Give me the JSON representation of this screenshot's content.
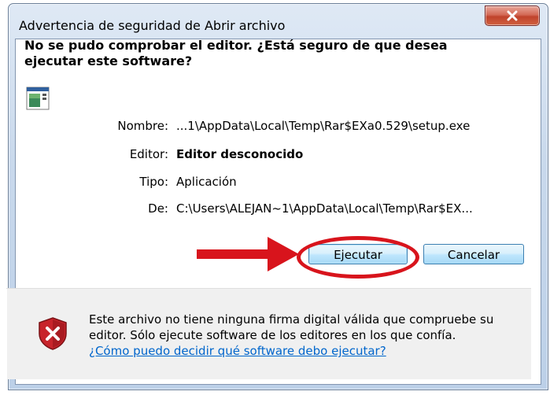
{
  "window": {
    "title": "Advertencia de seguridad de Abrir archivo"
  },
  "dialog": {
    "heading": "No se pudo comprobar el editor. ¿Está seguro de que desea ejecutar este software?",
    "fields": [
      {
        "label": "Nombre:",
        "value": "...1\\AppData\\Local\\Temp\\Rar$EXa0.529\\setup.exe"
      },
      {
        "label": "Editor:",
        "value": "Editor desconocido"
      },
      {
        "label": "Tipo:",
        "value": "Aplicación"
      },
      {
        "label": "De:",
        "value": "C:\\Users\\ALEJAN~1\\AppData\\Local\\Temp\\Rar$EX..."
      }
    ],
    "run_button": "Ejecutar",
    "cancel_button": "Cancelar"
  },
  "footer": {
    "warning_text": "Este archivo no tiene ninguna firma digital válida que compruebe su editor. Sólo ejecute software de los editores en los que confía.",
    "help_link": "¿Cómo puedo decidir qué software debo ejecutar?"
  },
  "colors": {
    "annotation": "#d8141c",
    "link": "#0066cc",
    "close_button": "#c0432c"
  }
}
